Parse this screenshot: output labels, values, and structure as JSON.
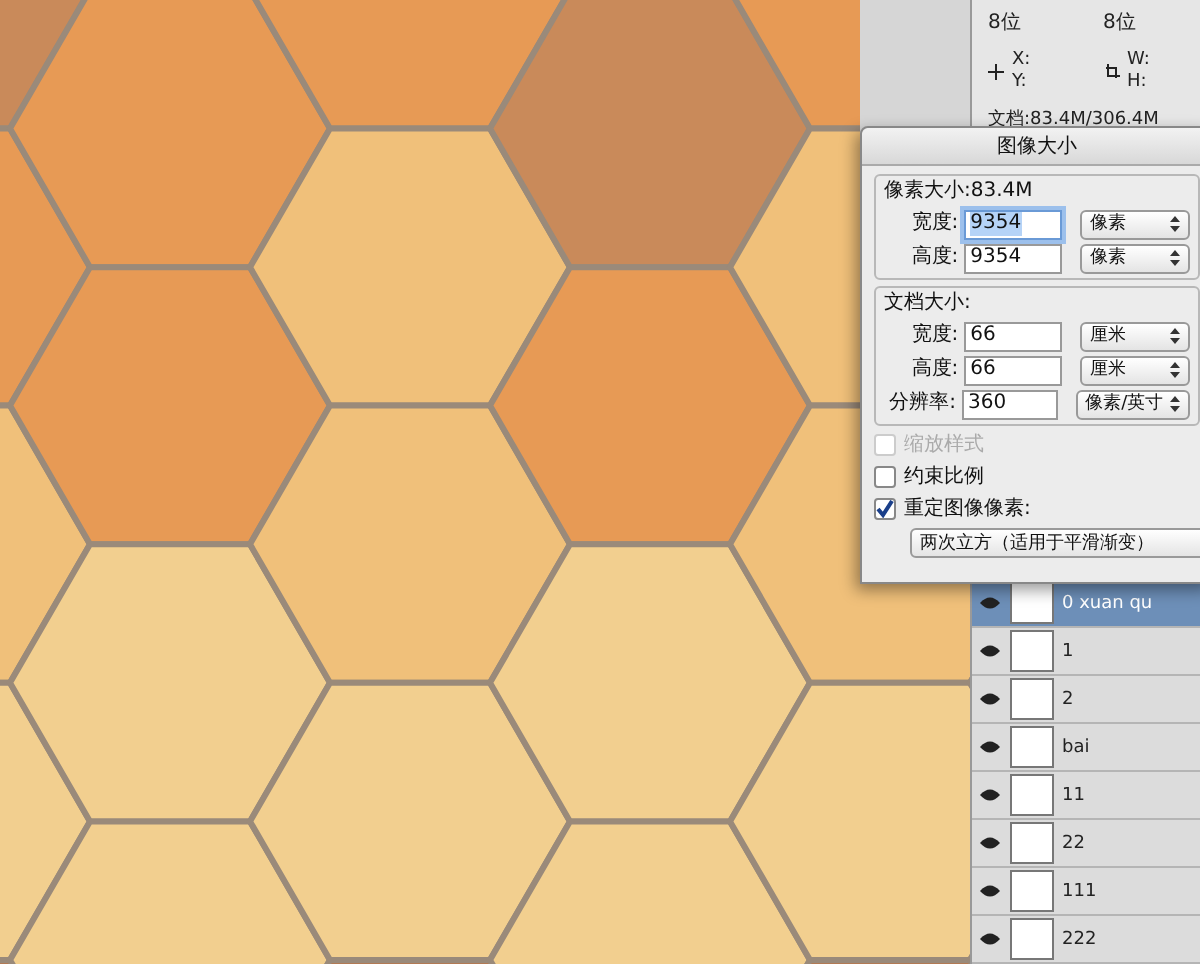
{
  "info_panel": {
    "bit_depths": [
      "8位",
      "8位"
    ],
    "position_labels": [
      "X:",
      "Y:"
    ],
    "size_labels": [
      "W:",
      "H:"
    ],
    "document": "文档:83.4M/306.4M"
  },
  "dialog": {
    "title": "图像大小",
    "pixel_section": {
      "title": "像素大小:83.4M",
      "fields": [
        {
          "label": "宽度:",
          "value": "9354",
          "unit": "像素",
          "focused": true
        },
        {
          "label": "高度:",
          "value": "9354",
          "unit": "像素",
          "focused": false
        }
      ]
    },
    "document_section": {
      "title": "文档大小:",
      "fields": [
        {
          "label": "宽度:",
          "value": "66",
          "unit": "厘米",
          "focused": false
        },
        {
          "label": "高度:",
          "value": "66",
          "unit": "厘米",
          "focused": false
        },
        {
          "label": "分辨率:",
          "value": "360",
          "unit": "像素/英寸",
          "focused": false
        }
      ]
    },
    "options": [
      {
        "label": "缩放样式",
        "checked": false,
        "disabled": true
      },
      {
        "label": "约束比例",
        "checked": false,
        "disabled": false
      },
      {
        "label": "重定图像像素:",
        "checked": true,
        "disabled": false
      }
    ],
    "resample": "两次立方（适用于平滑渐变）"
  },
  "layers": [
    {
      "name": "0 xuan qu",
      "selected": true
    },
    {
      "name": "1",
      "selected": false
    },
    {
      "name": "2",
      "selected": false
    },
    {
      "name": "bai",
      "selected": false
    },
    {
      "name": "11",
      "selected": false
    },
    {
      "name": "22",
      "selected": false
    },
    {
      "name": "111",
      "selected": false
    },
    {
      "name": "222",
      "selected": false
    }
  ]
}
